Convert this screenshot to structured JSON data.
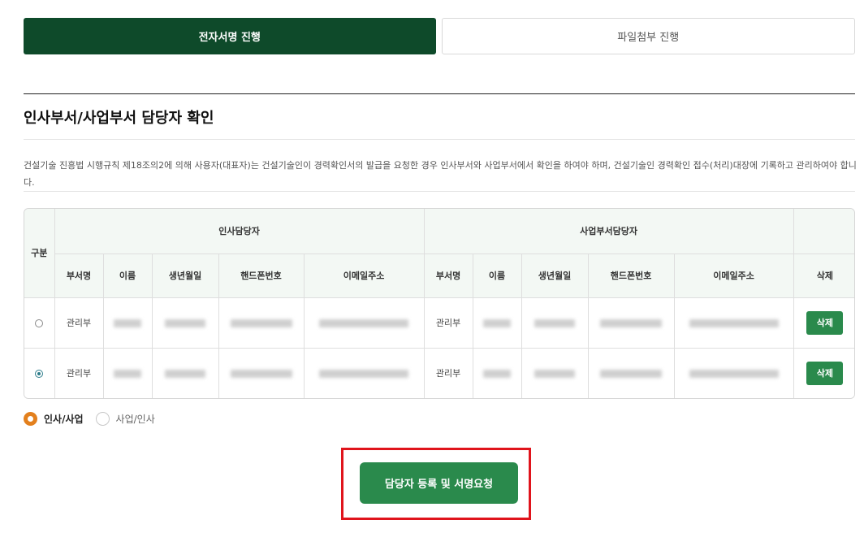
{
  "tabs": {
    "esign": "전자서명 진행",
    "file_attach": "파일첨부 진행"
  },
  "section": {
    "title": "인사부서/사업부서 담당자 확인",
    "description": "건설기술 진흥법 시행규칙 제18조의2에 의해 사용자(대표자)는 건설기술인이 경력확인서의 발급을 요청한 경우 인사부서와 사업부서에서 확인을 하여야 하며, 건설기술인 경력확인 접수(처리)대장에 기록하고 관리하여야 합니다."
  },
  "table": {
    "col_category": "구분",
    "group_hr": "인사담당자",
    "group_biz": "사업부서담당자",
    "col_delete": "삭제",
    "subheaders": [
      "부서명",
      "이름",
      "생년월일",
      "핸드폰번호",
      "이메일주소"
    ],
    "rows": [
      {
        "selected": false,
        "hr_dept": "관리부",
        "biz_dept": "관리부",
        "delete_label": "삭제"
      },
      {
        "selected": true,
        "hr_dept": "관리부",
        "biz_dept": "관리부",
        "delete_label": "삭제"
      }
    ]
  },
  "order_options": {
    "hr_first": "인사/사업",
    "biz_first": "사업/인사",
    "selected": "hr_first"
  },
  "submit": {
    "label": "담당자 등록 및 서명요청"
  },
  "colors": {
    "active_tab": "#0e4a2a",
    "button_green": "#2a8a4c",
    "radio_orange": "#e3801d",
    "highlight_red": "#e0141c"
  }
}
